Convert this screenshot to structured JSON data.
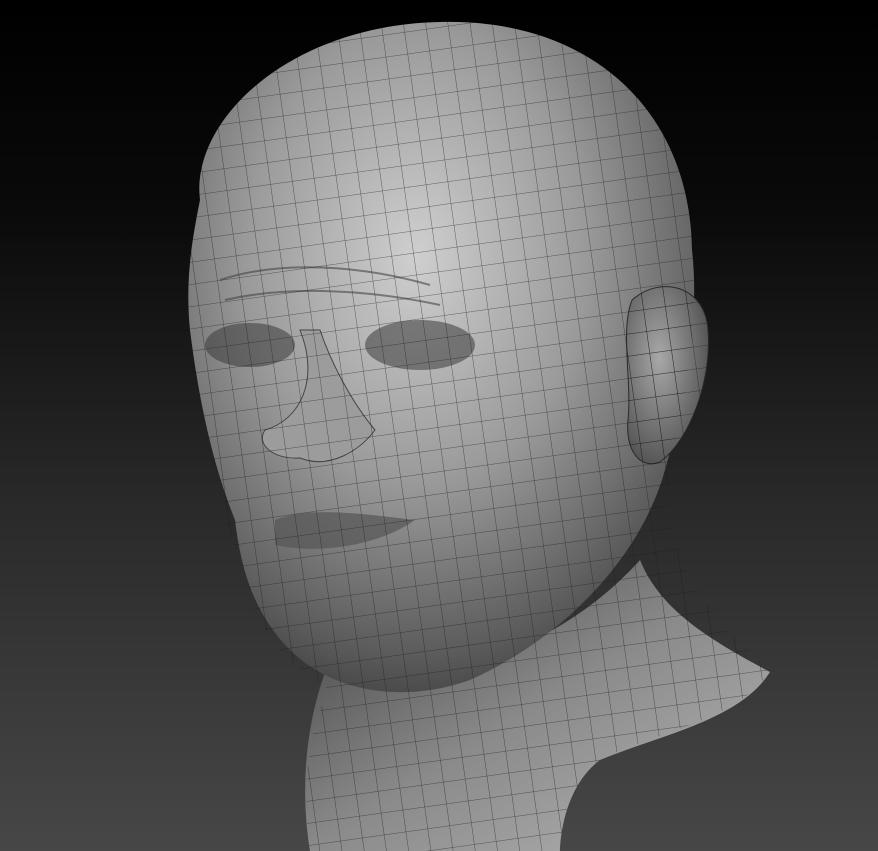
{
  "viewport": {
    "background_top": "#000000",
    "background_bottom": "#474747"
  },
  "model": {
    "kind": "sculpted-head-wireframe",
    "material_light": "#cfcfcf",
    "material_mid": "#8c8c8c",
    "material_dark": "#2a2a2a",
    "wire_color": "#1a1a1a"
  }
}
